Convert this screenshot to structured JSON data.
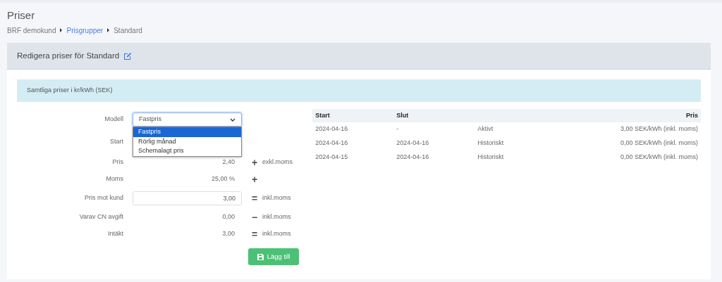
{
  "page": {
    "title": "Priser"
  },
  "breadcrumb": [
    {
      "label": "BRF demokund",
      "link": false
    },
    {
      "label": "Prisgrupper",
      "link": true
    },
    {
      "label": "Standard",
      "link": false
    }
  ],
  "card": {
    "title": "Redigera priser för Standard"
  },
  "info": "Samtliga priser i kr/kWh (SEK)",
  "form": {
    "rows": [
      {
        "kind": "select",
        "label": "Modell",
        "value": "Fastpris",
        "expanded": true,
        "options": [
          {
            "label": "Fastpris",
            "selected": true
          },
          {
            "label": "Rörlig månad",
            "selected": false
          },
          {
            "label": "Schemalagt pris",
            "selected": false
          }
        ]
      },
      {
        "kind": "hidden",
        "label": "Start"
      },
      {
        "kind": "text",
        "label": "Pris",
        "value": "2,40",
        "op": "+",
        "suffix": "exkl.moms"
      },
      {
        "kind": "text",
        "label": "Moms",
        "value": "25,00 %",
        "op": "+"
      },
      {
        "kind": "input",
        "label": "Pris mot kund",
        "value": "3,00",
        "op": "=",
        "suffix": "inkl.moms"
      },
      {
        "kind": "text",
        "label": "Varav CN avgift",
        "value": "0,00",
        "op": "−",
        "suffix": "inkl.moms"
      },
      {
        "kind": "text",
        "label": "Intäkt",
        "value": "3,00",
        "op": "=",
        "suffix": "inkl.moms"
      }
    ],
    "button": "Lägg till"
  },
  "table": {
    "columns": [
      "Start",
      "Slut",
      "",
      "Pris"
    ],
    "rows": [
      [
        "2024-04-16",
        "-",
        "Aktivt",
        "3,00 SEK/kWh (inkl. moms)"
      ],
      [
        "2024-04-16",
        "2024-04-16",
        "Historiskt",
        "0,00 SEK/kWh (inkl. moms)"
      ],
      [
        "2024-04-15",
        "2024-04-16",
        "Historiskt",
        "0,00 SEK/kWh (inkl. moms)"
      ]
    ]
  }
}
